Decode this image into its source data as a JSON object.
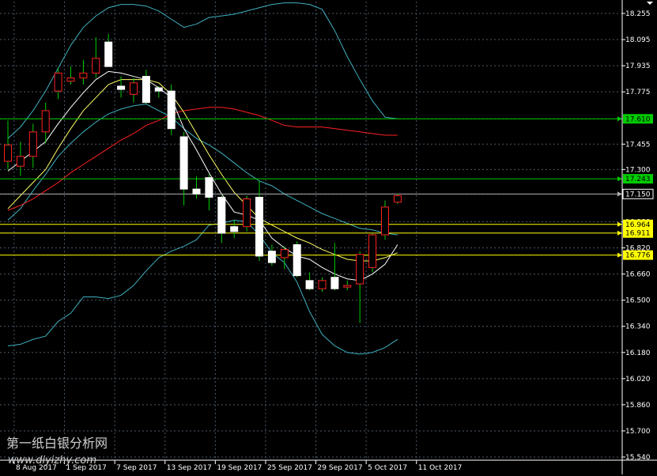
{
  "colors": {
    "background": "#000000",
    "grid": "#4a5a6a",
    "bull_body": "#000000",
    "bull_border": "#ff2020",
    "bear_body": "#ffffff",
    "bear_border": "#ffffff",
    "wick": "#00cc00",
    "ma_fast": "#ffffff",
    "ma_mid": "#ffff66",
    "ma_slow": "#ff2020",
    "bollinger": "#3fb0c0",
    "level_green": "#00cc00",
    "level_yellow": "#ffff00",
    "level_grey": "#b0b0b0",
    "axis_text": "#ffffff"
  },
  "watermark": {
    "line1": "第一纸白银分析网",
    "line2": "www.diyizhy.com"
  },
  "chart_data": {
    "type": "candlestick",
    "ylim": [
      15.5,
      18.3
    ],
    "yticks": [
      "18.255",
      "18.095",
      "17.935",
      "17.775",
      "17.610",
      "17.455",
      "17.300",
      "17.150",
      "16.980",
      "16.820",
      "16.660",
      "16.500",
      "16.340",
      "16.180",
      "16.020",
      "15.860",
      "15.700",
      "15.540"
    ],
    "ytick_values": [
      18.255,
      18.095,
      17.935,
      17.775,
      17.61,
      17.455,
      17.3,
      17.15,
      16.98,
      16.82,
      16.66,
      16.5,
      16.34,
      16.18,
      16.02,
      15.86,
      15.7,
      15.54
    ],
    "xticks": [
      "8 Aug 2017",
      "1 Sep 2017",
      "7 Sep 2017",
      "13 Sep 2017",
      "19 Sep 2017",
      "25 Sep 2017",
      "29 Sep 2017",
      "5 Oct 2017",
      "11 Oct 2017"
    ],
    "xtick_bars": [
      0.5,
      4.5,
      8.5,
      12.5,
      16.5,
      20.5,
      24.5,
      28.5,
      32.5
    ],
    "candles": [
      {
        "o": 17.35,
        "h": 17.6,
        "l": 17.3,
        "c": 17.45
      },
      {
        "o": 17.32,
        "h": 17.47,
        "l": 17.26,
        "c": 17.38
      },
      {
        "o": 17.38,
        "h": 17.58,
        "l": 17.31,
        "c": 17.53
      },
      {
        "o": 17.53,
        "h": 17.71,
        "l": 17.46,
        "c": 17.66
      },
      {
        "o": 17.78,
        "h": 17.92,
        "l": 17.73,
        "c": 17.89
      },
      {
        "o": 17.84,
        "h": 17.93,
        "l": 17.82,
        "c": 17.86
      },
      {
        "o": 17.86,
        "h": 17.97,
        "l": 17.82,
        "c": 17.89
      },
      {
        "o": 17.89,
        "h": 18.11,
        "l": 17.86,
        "c": 17.98
      },
      {
        "o": 18.08,
        "h": 18.13,
        "l": 17.95,
        "c": 17.93
      },
      {
        "o": 17.81,
        "h": 17.87,
        "l": 17.74,
        "c": 17.79
      },
      {
        "o": 17.76,
        "h": 17.86,
        "l": 17.71,
        "c": 17.83
      },
      {
        "o": 17.87,
        "h": 17.91,
        "l": 17.7,
        "c": 17.71
      },
      {
        "o": 17.8,
        "h": 17.81,
        "l": 17.74,
        "c": 17.78
      },
      {
        "o": 17.78,
        "h": 17.82,
        "l": 17.51,
        "c": 17.55
      },
      {
        "o": 17.5,
        "h": 17.53,
        "l": 17.08,
        "c": 17.18
      },
      {
        "o": 17.18,
        "h": 17.26,
        "l": 17.12,
        "c": 17.15
      },
      {
        "o": 17.25,
        "h": 17.27,
        "l": 17.05,
        "c": 17.13
      },
      {
        "o": 17.13,
        "h": 17.14,
        "l": 16.85,
        "c": 16.91
      },
      {
        "o": 16.95,
        "h": 16.99,
        "l": 16.88,
        "c": 16.92
      },
      {
        "o": 16.95,
        "h": 17.14,
        "l": 16.92,
        "c": 17.12
      },
      {
        "o": 17.13,
        "h": 17.23,
        "l": 16.74,
        "c": 16.77
      },
      {
        "o": 16.8,
        "h": 16.84,
        "l": 16.71,
        "c": 16.73
      },
      {
        "o": 16.76,
        "h": 16.83,
        "l": 16.69,
        "c": 16.81
      },
      {
        "o": 16.84,
        "h": 16.86,
        "l": 16.64,
        "c": 16.65
      },
      {
        "o": 16.62,
        "h": 16.67,
        "l": 16.56,
        "c": 16.57
      },
      {
        "o": 16.57,
        "h": 16.64,
        "l": 16.55,
        "c": 16.62
      },
      {
        "o": 16.64,
        "h": 16.85,
        "l": 16.56,
        "c": 16.57
      },
      {
        "o": 16.58,
        "h": 16.62,
        "l": 16.56,
        "c": 16.59
      },
      {
        "o": 16.6,
        "h": 16.8,
        "l": 16.36,
        "c": 16.78
      },
      {
        "o": 16.7,
        "h": 16.91,
        "l": 16.67,
        "c": 16.9
      },
      {
        "o": 16.9,
        "h": 17.11,
        "l": 16.87,
        "c": 17.07
      },
      {
        "o": 17.1,
        "h": 17.15,
        "l": 17.09,
        "c": 17.14
      }
    ],
    "ma_fast": [
      17.29,
      17.35,
      17.41,
      17.47,
      17.58,
      17.68,
      17.77,
      17.85,
      17.9,
      17.89,
      17.87,
      17.85,
      17.8,
      17.74,
      17.55,
      17.42,
      17.28,
      17.15,
      17.04,
      17.02,
      16.99,
      16.88,
      16.82,
      16.77,
      16.75,
      16.7,
      16.66,
      16.63,
      16.62,
      16.66,
      16.72,
      16.84
    ],
    "ma_mid": [
      17.06,
      17.14,
      17.22,
      17.3,
      17.43,
      17.55,
      17.66,
      17.74,
      17.82,
      17.85,
      17.85,
      17.85,
      17.83,
      17.76,
      17.65,
      17.52,
      17.39,
      17.27,
      17.16,
      17.08,
      17.0,
      16.96,
      16.92,
      16.88,
      16.85,
      16.81,
      16.78,
      16.75,
      16.74,
      16.74,
      16.76,
      16.79
    ],
    "ma_slow": [
      17.05,
      17.08,
      17.12,
      17.17,
      17.22,
      17.28,
      17.33,
      17.38,
      17.43,
      17.48,
      17.52,
      17.57,
      17.6,
      17.64,
      17.66,
      17.67,
      17.68,
      17.68,
      17.67,
      17.65,
      17.63,
      17.6,
      17.57,
      17.56,
      17.56,
      17.56,
      17.55,
      17.54,
      17.53,
      17.52,
      17.51,
      17.51
    ],
    "boll_upper": [
      17.49,
      17.56,
      17.66,
      17.78,
      17.92,
      18.06,
      18.17,
      18.24,
      18.29,
      18.31,
      18.31,
      18.3,
      18.27,
      18.22,
      18.17,
      18.19,
      18.23,
      18.24,
      18.25,
      18.27,
      18.29,
      18.31,
      18.32,
      18.32,
      18.31,
      18.28,
      18.15,
      17.99,
      17.85,
      17.72,
      17.62,
      17.61
    ],
    "boll_lower": [
      16.22,
      16.23,
      16.26,
      16.28,
      16.37,
      16.42,
      16.52,
      16.52,
      16.51,
      16.53,
      16.59,
      16.68,
      16.76,
      16.8,
      16.83,
      16.87,
      16.96,
      16.97,
      16.99,
      16.98,
      16.9,
      16.79,
      16.73,
      16.61,
      16.43,
      16.29,
      16.22,
      16.18,
      16.17,
      16.18,
      16.21,
      16.26
    ],
    "boll_mid": [
      16.99,
      17.06,
      17.17,
      17.27,
      17.38,
      17.46,
      17.53,
      17.59,
      17.64,
      17.67,
      17.69,
      17.7,
      17.66,
      17.62,
      17.55,
      17.49,
      17.45,
      17.4,
      17.34,
      17.28,
      17.23,
      17.2,
      17.15,
      17.11,
      17.07,
      17.03,
      17.0,
      16.97,
      16.94,
      16.93,
      16.91,
      16.9
    ],
    "levels": [
      {
        "label": "17.610",
        "value": 17.61,
        "color": "green"
      },
      {
        "label": "17.243",
        "value": 17.243,
        "color": "green"
      },
      {
        "label": "17.150",
        "value": 17.15,
        "color": "grey"
      },
      {
        "label": "16.964",
        "value": 16.964,
        "color": "yellow"
      },
      {
        "label": "16.911",
        "value": 16.911,
        "color": "yellow"
      },
      {
        "label": "16.776",
        "value": 16.776,
        "color": "yellow"
      }
    ]
  }
}
